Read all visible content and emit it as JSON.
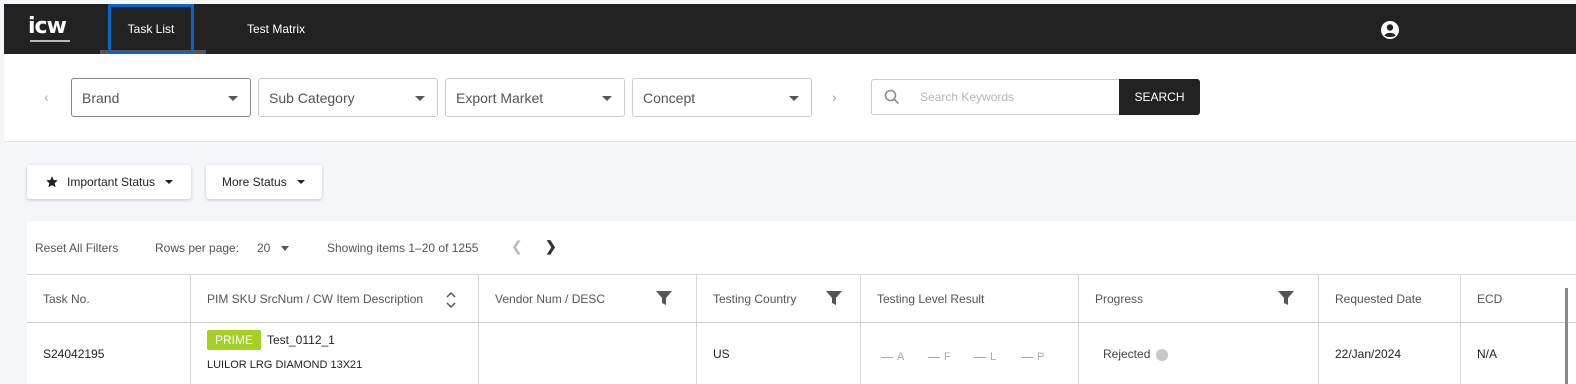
{
  "brand": {
    "logo": "icw"
  },
  "nav": {
    "tabs": [
      {
        "label": "Task List"
      },
      {
        "label": "Test Matrix"
      }
    ]
  },
  "filters": {
    "selects": [
      {
        "label": "Brand"
      },
      {
        "label": "Sub Category"
      },
      {
        "label": "Export Market"
      },
      {
        "label": "Concept"
      }
    ],
    "search_placeholder": "Search Keywords",
    "search_button": "SEARCH"
  },
  "status_buttons": {
    "important": "Important Status",
    "more": "More Status"
  },
  "table_tools": {
    "reset": "Reset All Filters",
    "rows_label": "Rows per page:",
    "rows_value": "20",
    "showing": "Showing items 1–20 of 1255"
  },
  "columns": [
    "Task No.",
    "PIM SKU SrcNum / CW Item Description",
    "Vendor Num / DESC",
    "Testing Country",
    "Testing Level Result",
    "Progress",
    "Requested Date",
    "ECD"
  ],
  "rows": [
    {
      "task_no": "S24042195",
      "badge": "PRIME",
      "sku": "Test_0112_1",
      "desc": "LUILOR LRG DIAMOND 13X21",
      "vendor": "",
      "country": "US",
      "levels": [
        "A",
        "F",
        "L",
        "P"
      ],
      "progress": "Rejected",
      "requested": "22/Jan/2024",
      "ecd": "N/A"
    }
  ],
  "colors": {
    "topbar": "#222222",
    "active_tab_border": "#0a66c2",
    "prime": "#a2d023"
  }
}
